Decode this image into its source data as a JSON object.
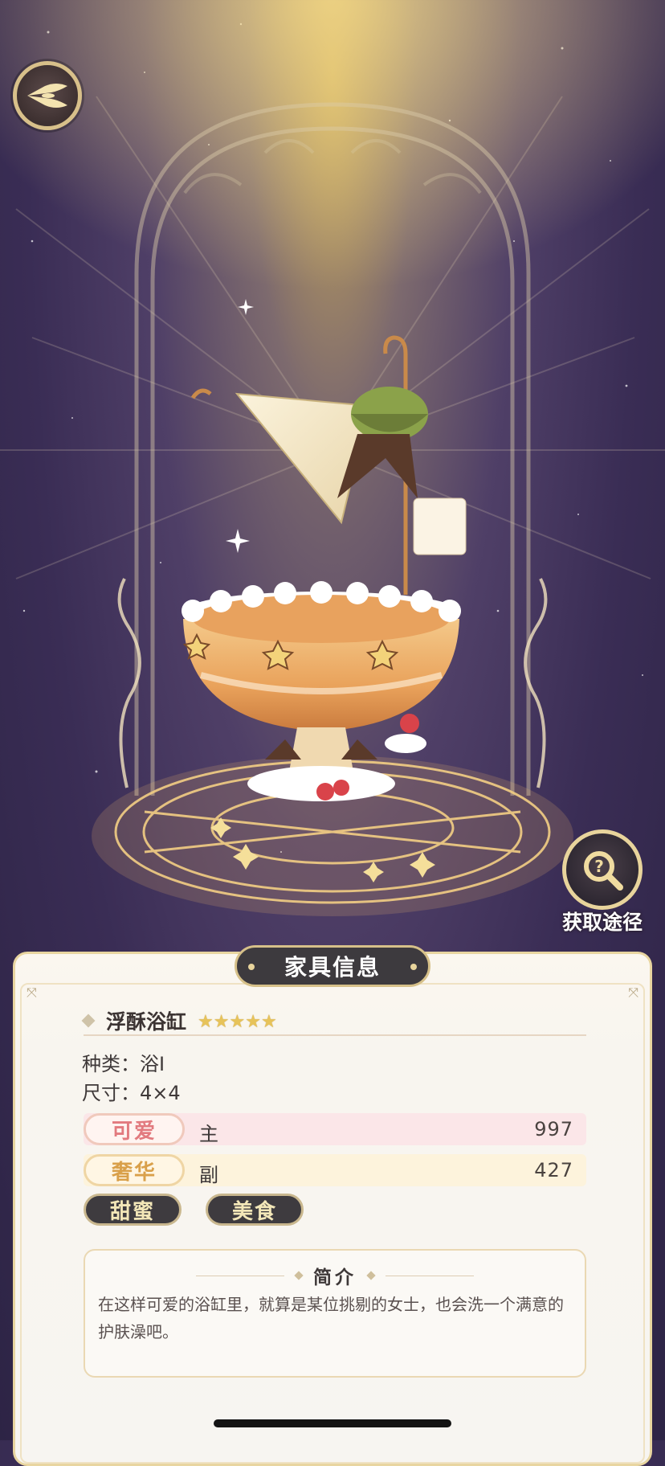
{
  "nav": {
    "back_icon": "wing-back-icon"
  },
  "acquire": {
    "label": "获取途径",
    "icon": "magnifier-question-icon"
  },
  "panel": {
    "title": "家具信息",
    "item": {
      "name": "浮酥浴缸",
      "rating": 5,
      "stars": [
        "★",
        "★",
        "★",
        "★",
        "★"
      ],
      "category_label": "种类：",
      "category_value": "浴I",
      "size_label": "尺寸：",
      "size_value": "4×4"
    },
    "stats": [
      {
        "tag": "可爱",
        "role": "主",
        "value": "997",
        "tag_color": "#e27a7f",
        "bar_color": "#fbe6e8"
      },
      {
        "tag": "奢华",
        "role": "副",
        "value": "427",
        "tag_color": "#d9a04a",
        "bar_color": "#fdf3dc"
      }
    ],
    "tags": [
      "甜蜜",
      "美食"
    ],
    "intro": {
      "title": "简介",
      "text": "在这样可爱的浴缸里，就算是某位挑剔的女士，也会洗一个满意的护肤澡吧。"
    }
  }
}
